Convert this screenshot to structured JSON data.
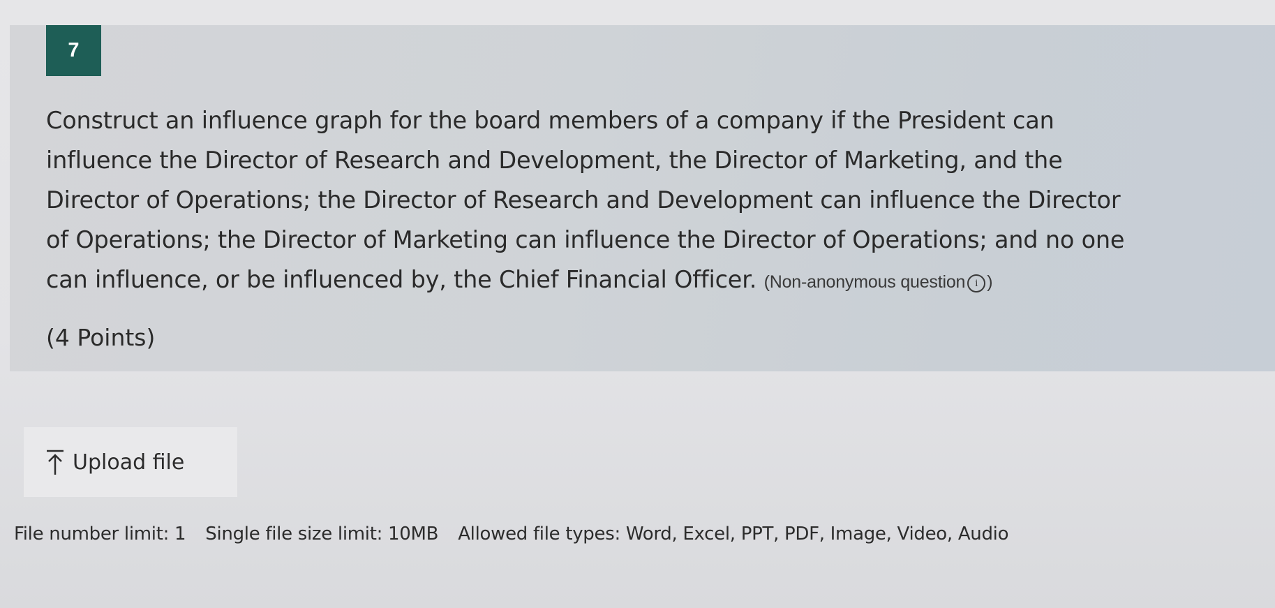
{
  "question": {
    "number": "7",
    "lines": [
      "Construct an influence graph for the board members of a company if the President can",
      "influence the Director of Research and Development, the Director of Marketing, and the",
      "Director of Operations; the Director of Research and Development can influence the Director",
      "of Operations; the Director of Marketing can influence the Director of Operations; and no one",
      "can influence, or be influenced by, the Chief Financial Officer."
    ],
    "tag": "(Non-anonymous question",
    "tag_close": ")",
    "info_icon": "info-icon",
    "points": "(4 Points)"
  },
  "upload": {
    "label": "Upload file",
    "icon": "upload-icon"
  },
  "limits": {
    "file_number": "File number limit: 1",
    "file_size": "Single file size limit: 10MB",
    "file_types": "Allowed file types: Word, Excel, PPT, PDF, Image, Video, Audio"
  }
}
